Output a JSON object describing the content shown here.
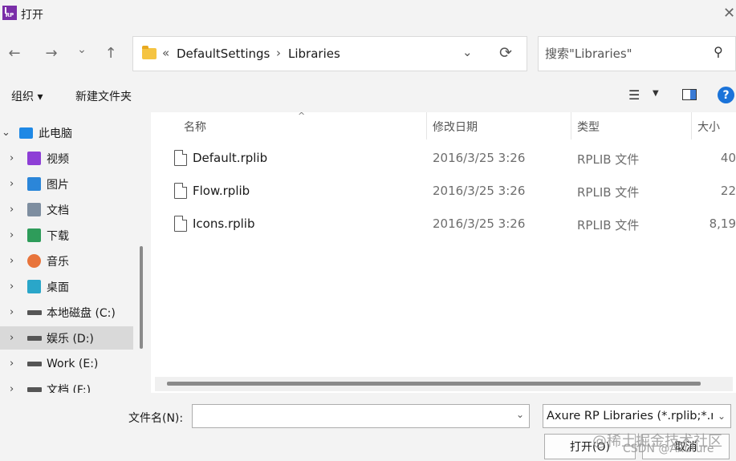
{
  "window": {
    "title": "打开",
    "app_logo_text": "RP",
    "close_glyph": "✕"
  },
  "navigation": {
    "back_glyph": "←",
    "forward_glyph": "→",
    "recent_glyph": "⌄",
    "up_glyph": "↑",
    "address": {
      "overflow_glyph": "«",
      "crumbs": [
        "DefaultSettings",
        "Libraries"
      ],
      "separator": "›",
      "dropdown_glyph": "⌄",
      "refresh_glyph": "⟳"
    },
    "search": {
      "placeholder": "搜索\"Libraries\"",
      "icon_glyph": "⚲"
    }
  },
  "toolbar": {
    "organize_label": "组织 ▾",
    "new_folder_label": "新建文件夹",
    "view_glyph": "☰",
    "view_caret": "▼",
    "help_glyph": "?"
  },
  "sidebar": {
    "items": [
      {
        "label": "此电脑",
        "chevron": "⌄",
        "icon": "monitor-icon",
        "color": "#1e88e5"
      },
      {
        "label": "视频",
        "chevron": "›",
        "icon": "video-icon",
        "color": "#8e3fd6"
      },
      {
        "label": "图片",
        "chevron": "›",
        "icon": "pictures-icon",
        "color": "#2b86d9"
      },
      {
        "label": "文档",
        "chevron": "›",
        "icon": "documents-icon",
        "color": "#7e8ea0"
      },
      {
        "label": "下载",
        "chevron": "›",
        "icon": "download-icon",
        "color": "#2e9c5a"
      },
      {
        "label": "音乐",
        "chevron": "›",
        "icon": "music-icon",
        "color": "#e8743b"
      },
      {
        "label": "桌面",
        "chevron": "›",
        "icon": "desktop-icon",
        "color": "#2aa6c9"
      },
      {
        "label": "本地磁盘 (C:)",
        "chevron": "›",
        "icon": "system-drive-icon",
        "color": "#555555"
      },
      {
        "label": "娱乐 (D:)",
        "chevron": "›",
        "icon": "drive-icon",
        "color": "#555555"
      },
      {
        "label": "Work (E:)",
        "chevron": "›",
        "icon": "drive-icon",
        "color": "#555555"
      },
      {
        "label": "文档 (F:)",
        "chevron": "›",
        "icon": "drive-icon",
        "color": "#555555"
      }
    ],
    "selected_index": 8
  },
  "file_list": {
    "columns": [
      "名称",
      "修改日期",
      "类型",
      "大小"
    ],
    "sort_glyph": "^",
    "rows": [
      {
        "name": "Default.rplib",
        "date": "2016/3/25 3:26",
        "type": "RPLIB 文件",
        "size": "40"
      },
      {
        "name": "Flow.rplib",
        "date": "2016/3/25 3:26",
        "type": "RPLIB 文件",
        "size": "22"
      },
      {
        "name": "Icons.rplib",
        "date": "2016/3/25 3:26",
        "type": "RPLIB 文件",
        "size": "8,19"
      }
    ]
  },
  "bottom": {
    "filename_label": "文件名(N):",
    "filename_value": "",
    "filename_caret": "⌄",
    "filter_value": "Axure RP Libraries (*.rplib;*.r",
    "filter_caret": "⌄",
    "open_label": "打开(O)",
    "cancel_label": "取消"
  },
  "watermark": {
    "line1": "@稀土掘金技术社区",
    "line2": "CSDN @Axuture"
  }
}
